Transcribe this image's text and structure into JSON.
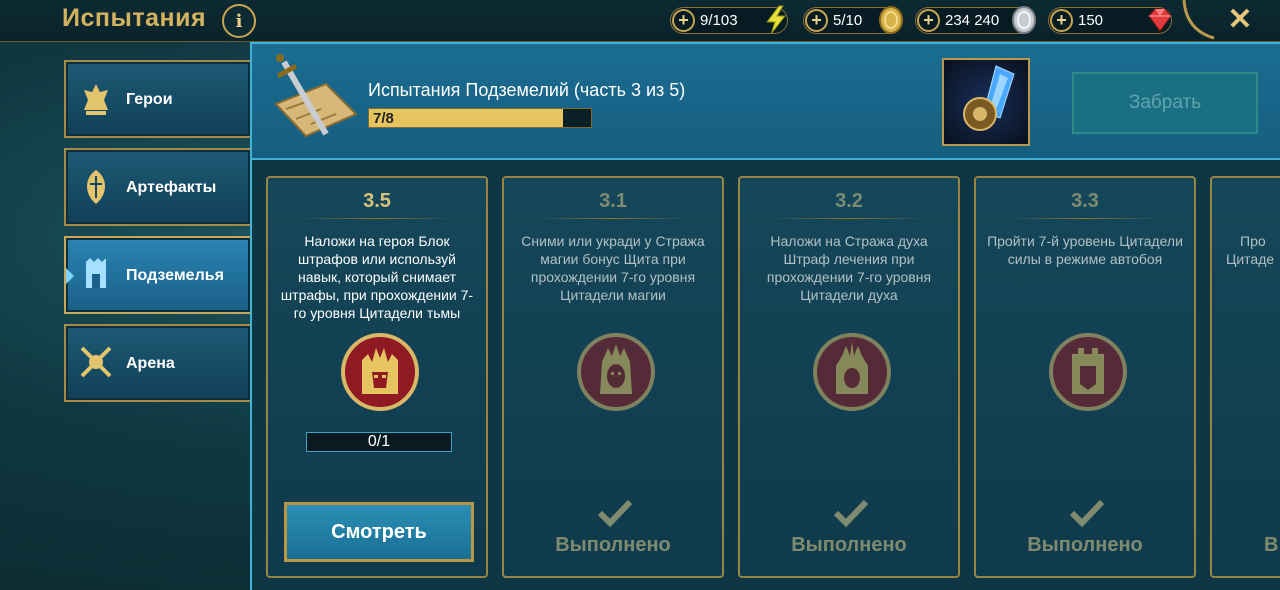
{
  "header": {
    "title": "Испытания",
    "info": "i",
    "resources": [
      {
        "value": "9/103",
        "icon": "energy-icon",
        "color": "#e8e140"
      },
      {
        "value": "5/10",
        "icon": "gold-coin-icon",
        "color": "#d6b44a"
      },
      {
        "value": "234 240",
        "icon": "silver-coin-icon",
        "color": "#c9ccd2"
      },
      {
        "value": "150",
        "icon": "ruby-icon",
        "color": "#e23b3b"
      }
    ],
    "close": "✕"
  },
  "sidebar": {
    "items": [
      {
        "label": "Герои",
        "icon": "heroes-icon"
      },
      {
        "label": "Артефакты",
        "icon": "artifacts-icon"
      },
      {
        "label": "Подземелья",
        "icon": "dungeons-icon",
        "active": true
      },
      {
        "label": "Арена",
        "icon": "arena-icon"
      }
    ]
  },
  "quest": {
    "title": "Испытания Подземелий (часть 3 из 5)",
    "progress_text": "7/8",
    "progress_fraction": 0.875,
    "claim_label": "Забрать"
  },
  "cards": [
    {
      "id": "3.5",
      "desc": "Наложи на героя Блок штрафов или используй навык, который снимает штрафы, при прохождении 7-го уровня Цитадели тьмы",
      "progress": "0/1",
      "button": "Смотреть",
      "icon": "dark-citadel-icon"
    },
    {
      "id": "3.1",
      "desc": "Сними или укради у Стража магии бонус Щита при прохождении 7-го уровня Цитадели магии",
      "status": "Выполнено",
      "icon": "magic-keeper-icon"
    },
    {
      "id": "3.2",
      "desc": "Наложи на Стража духа Штраф лечения при прохождении 7-го уровня Цитадели духа",
      "status": "Выполнено",
      "icon": "spirit-keeper-icon"
    },
    {
      "id": "3.3",
      "desc": "Пройти 7-й уровень Цитадели силы в режиме автобоя",
      "status": "Выполнено",
      "icon": "force-keeper-icon"
    },
    {
      "desc_partial_1": "Про",
      "desc_partial_2": "Цитаде",
      "status_partial": "В"
    }
  ]
}
